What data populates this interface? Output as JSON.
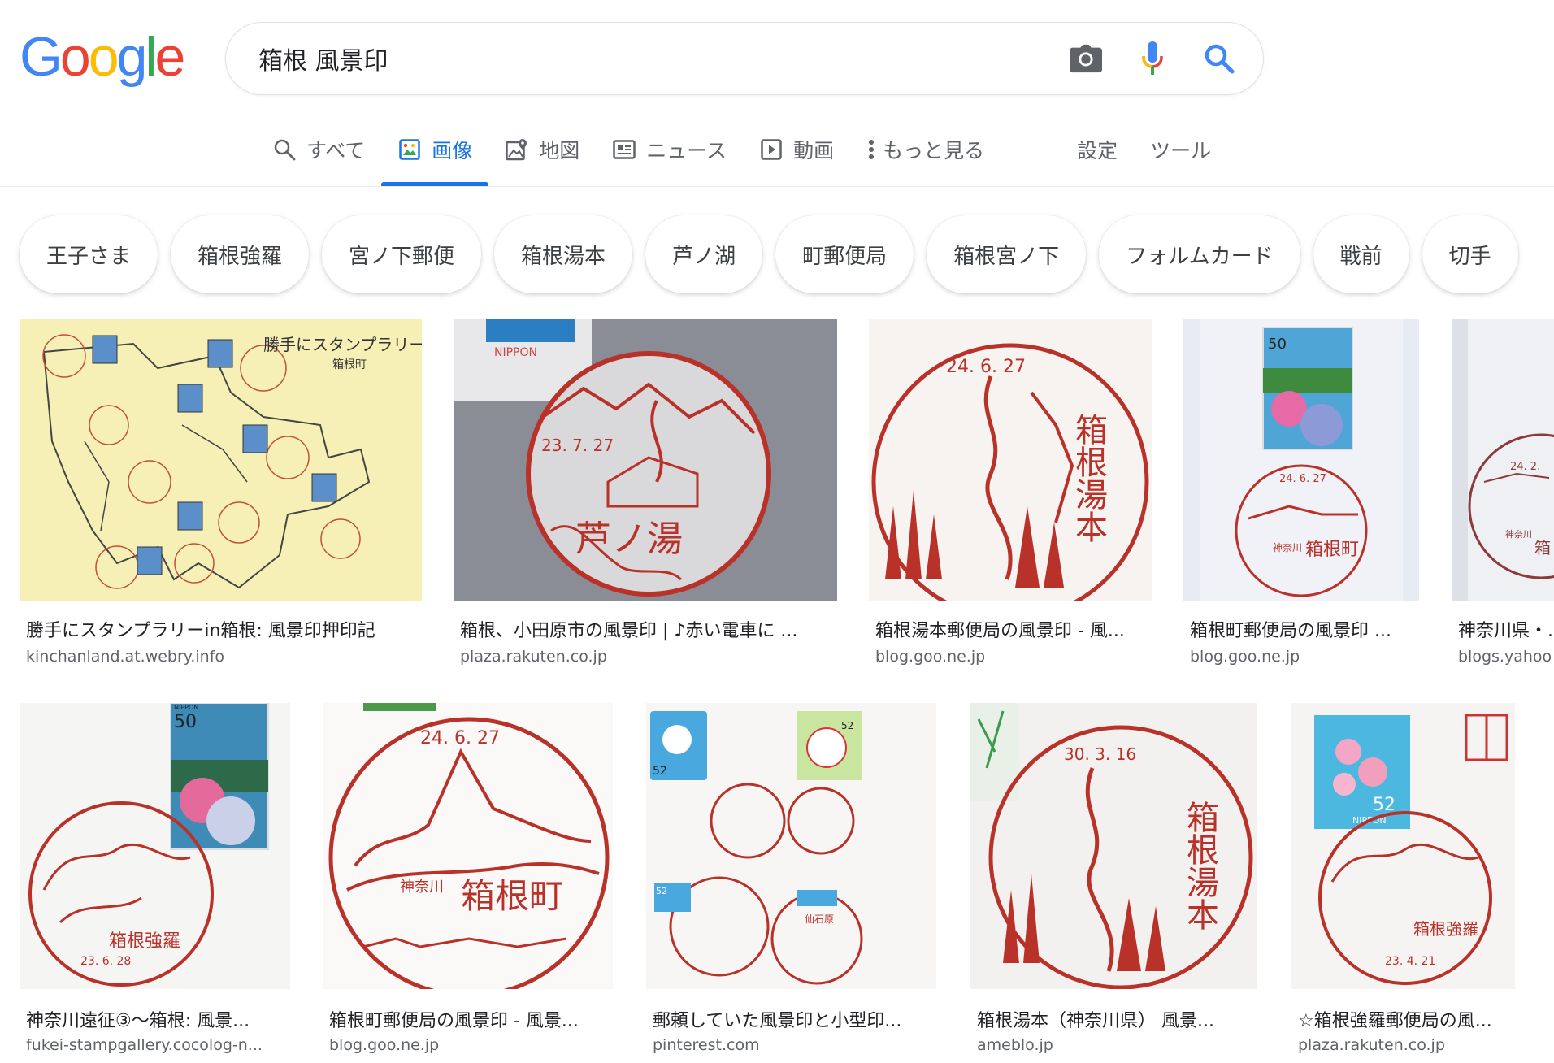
{
  "logo": {
    "letters": [
      "G",
      "o",
      "o",
      "g",
      "l",
      "e"
    ],
    "colors": [
      "#4285F4",
      "#EA4335",
      "#FBBC05",
      "#4285F4",
      "#34A853",
      "#EA4335"
    ]
  },
  "search": {
    "query": "箱根 風景印",
    "icons": [
      "camera-icon",
      "microphone-icon",
      "search-icon"
    ]
  },
  "tabs": [
    {
      "label": "すべて",
      "icon": "search-icon"
    },
    {
      "label": "画像",
      "icon": "image-icon",
      "active": true
    },
    {
      "label": "地図",
      "icon": "map-icon"
    },
    {
      "label": "ニュース",
      "icon": "news-icon"
    },
    {
      "label": "動画",
      "icon": "video-icon"
    },
    {
      "label": "もっと見る",
      "icon": "more-vertical-icon"
    },
    {
      "label": "設定"
    },
    {
      "label": "ツール"
    }
  ],
  "chips": [
    "王子さま",
    "箱根強羅",
    "宮ノ下郵便",
    "箱根湯本",
    "芦ノ湖",
    "町郵便局",
    "箱根宮ノ下",
    "フォルムカード",
    "戦前",
    "切手"
  ],
  "results": [
    {
      "title": "勝手にスタンプラリーin箱根: 風景印押印記",
      "site": "kinchanland.at.webry.info",
      "image": "hand-drawn stamp rally map with postage stamps"
    },
    {
      "title": "箱根、小田原市の風景印 | ♪赤い電車に ...",
      "site": "plaza.rakuten.co.jp",
      "image": "red postmark stamp photo"
    },
    {
      "title": "箱根湯本郵便局の風景印 - 風...",
      "site": "blog.goo.ne.jp",
      "image": "箱根湯本 red postmark"
    },
    {
      "title": "箱根町郵便局の風景印 ...",
      "site": "blog.goo.ne.jp",
      "image": "postcard with hydrangea stamp and 箱根町 postmark"
    },
    {
      "title": "神奈川県・...",
      "site": "blogs.yahoo",
      "image": "partially visible postmark"
    },
    {
      "title": "神奈川遠征③〜箱根: 風景...",
      "site": "fukei-stampgallery.cocolog-n...",
      "image": "箱根強羅 postmark with hydrangea stamp"
    },
    {
      "title": "箱根町郵便局の風景印 - 風景...",
      "site": "blog.goo.ne.jp",
      "image": "箱根町 red postmark close-up"
    },
    {
      "title": "郵頼していた風景印と小型印...",
      "site": "pinterest.com",
      "image": "collection of stamps and postmarks"
    },
    {
      "title": "箱根湯本（神奈川県） 風景...",
      "site": "ameblo.jp",
      "image": "箱根湯本 postmark"
    },
    {
      "title": "☆箱根強羅郵便局の風...",
      "site": "plaza.rakuten.co.jp",
      "image": "cherry blossom stamp with 箱根強羅 postmark"
    }
  ],
  "stamp_texts": {
    "r1_heading": "勝手にスタンプラリー",
    "r1_sub": "箱根町",
    "r2_nippon": "NIPPON",
    "r2_date": "23. 7. 27",
    "r2_name": "芦ノ湯",
    "r3_date": "24. 6. 27",
    "r3_name": "箱根湯本",
    "r4_value": "50",
    "r4_date": "24. 6. 27",
    "r4_pref": "神奈川",
    "r4_name": "箱根町",
    "r5_date": "24. 2.",
    "r5_pref": "神奈川",
    "r5_name": "箱",
    "r6_value": "50",
    "r6_nippon": "NIPPON",
    "r6_name": "箱根強羅",
    "r6_date": "23. 6. 28",
    "r7_date": "24. 6. 27",
    "r7_pref": "神奈川",
    "r7_name": "箱根町",
    "r8_value1": "52",
    "r8_value2": "52",
    "r8_value3": "52",
    "r8_name": "仙石原",
    "r9_date": "30. 3. 16",
    "r9_name": "箱根湯本",
    "r10_value": "52",
    "r10_nippon": "NIPPON",
    "r10_name": "箱根強羅",
    "r10_date": "23. 4. 21"
  },
  "colors": {
    "stamp_red": "#b8322a",
    "accent_blue": "#1a73e8"
  }
}
